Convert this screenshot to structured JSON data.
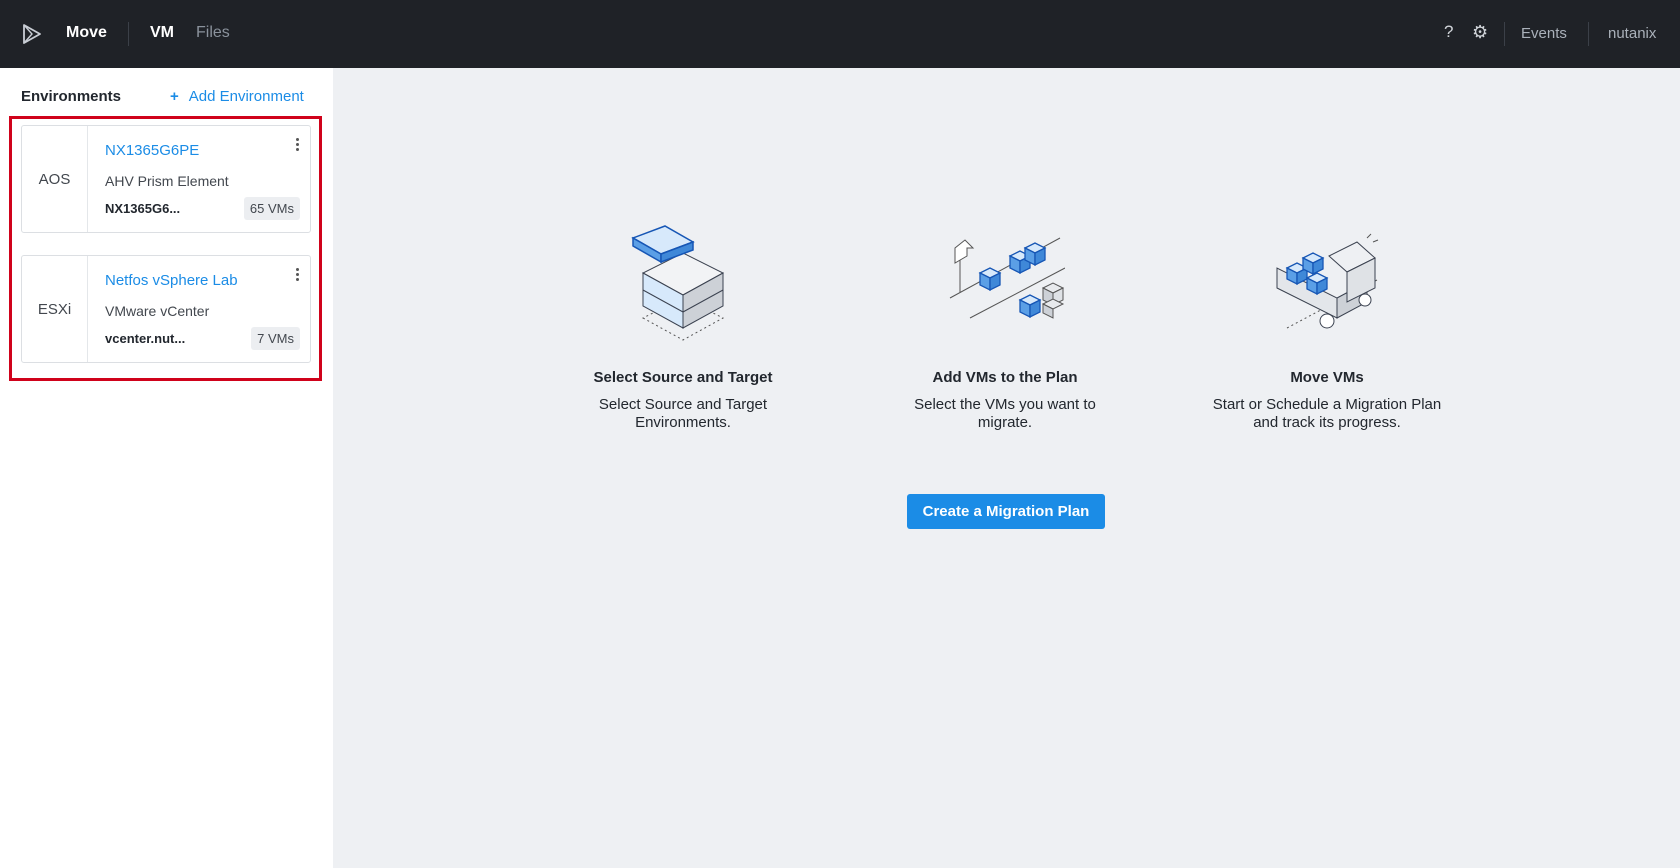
{
  "topbar": {
    "app_name": "Move",
    "nav": {
      "vm": "VM",
      "files": "Files"
    },
    "help_label": "?",
    "events_label": "Events",
    "user_label": "nutanix",
    "icons": {
      "logo": "play-outline-icon",
      "help": "question-icon",
      "settings": "gear-icon"
    }
  },
  "sidebar": {
    "title": "Environments",
    "add_label": "Add Environment",
    "add_symbol": "+",
    "environments": [
      {
        "type": "AOS",
        "name": "NX1365G6PE",
        "kind": "AHV Prism Element",
        "host": "NX1365G6...",
        "vm_count": "65 VMs"
      },
      {
        "type": "ESXi",
        "name": "Netfos vSphere Lab",
        "kind": "VMware vCenter",
        "host": "vcenter.nut...",
        "vm_count": "7 VMs"
      }
    ]
  },
  "main": {
    "steps": [
      {
        "title": "Select Source and Target",
        "desc": "Select Source and Target Environments.",
        "icon": "source-target-blocks-icon"
      },
      {
        "title": "Add VMs to the Plan",
        "desc": "Select the VMs you want to migrate.",
        "icon": "vm-cubes-conveyor-icon"
      },
      {
        "title": "Move VMs",
        "desc": "Start or Schedule a Migration Plan and track its progress.",
        "icon": "truck-icon"
      }
    ],
    "cta_label": "Create a Migration Plan"
  },
  "colors": {
    "accent": "#1b8ce6",
    "topbar": "#1f2227",
    "highlight": "#d0021b",
    "main_bg": "#eef0f3"
  }
}
